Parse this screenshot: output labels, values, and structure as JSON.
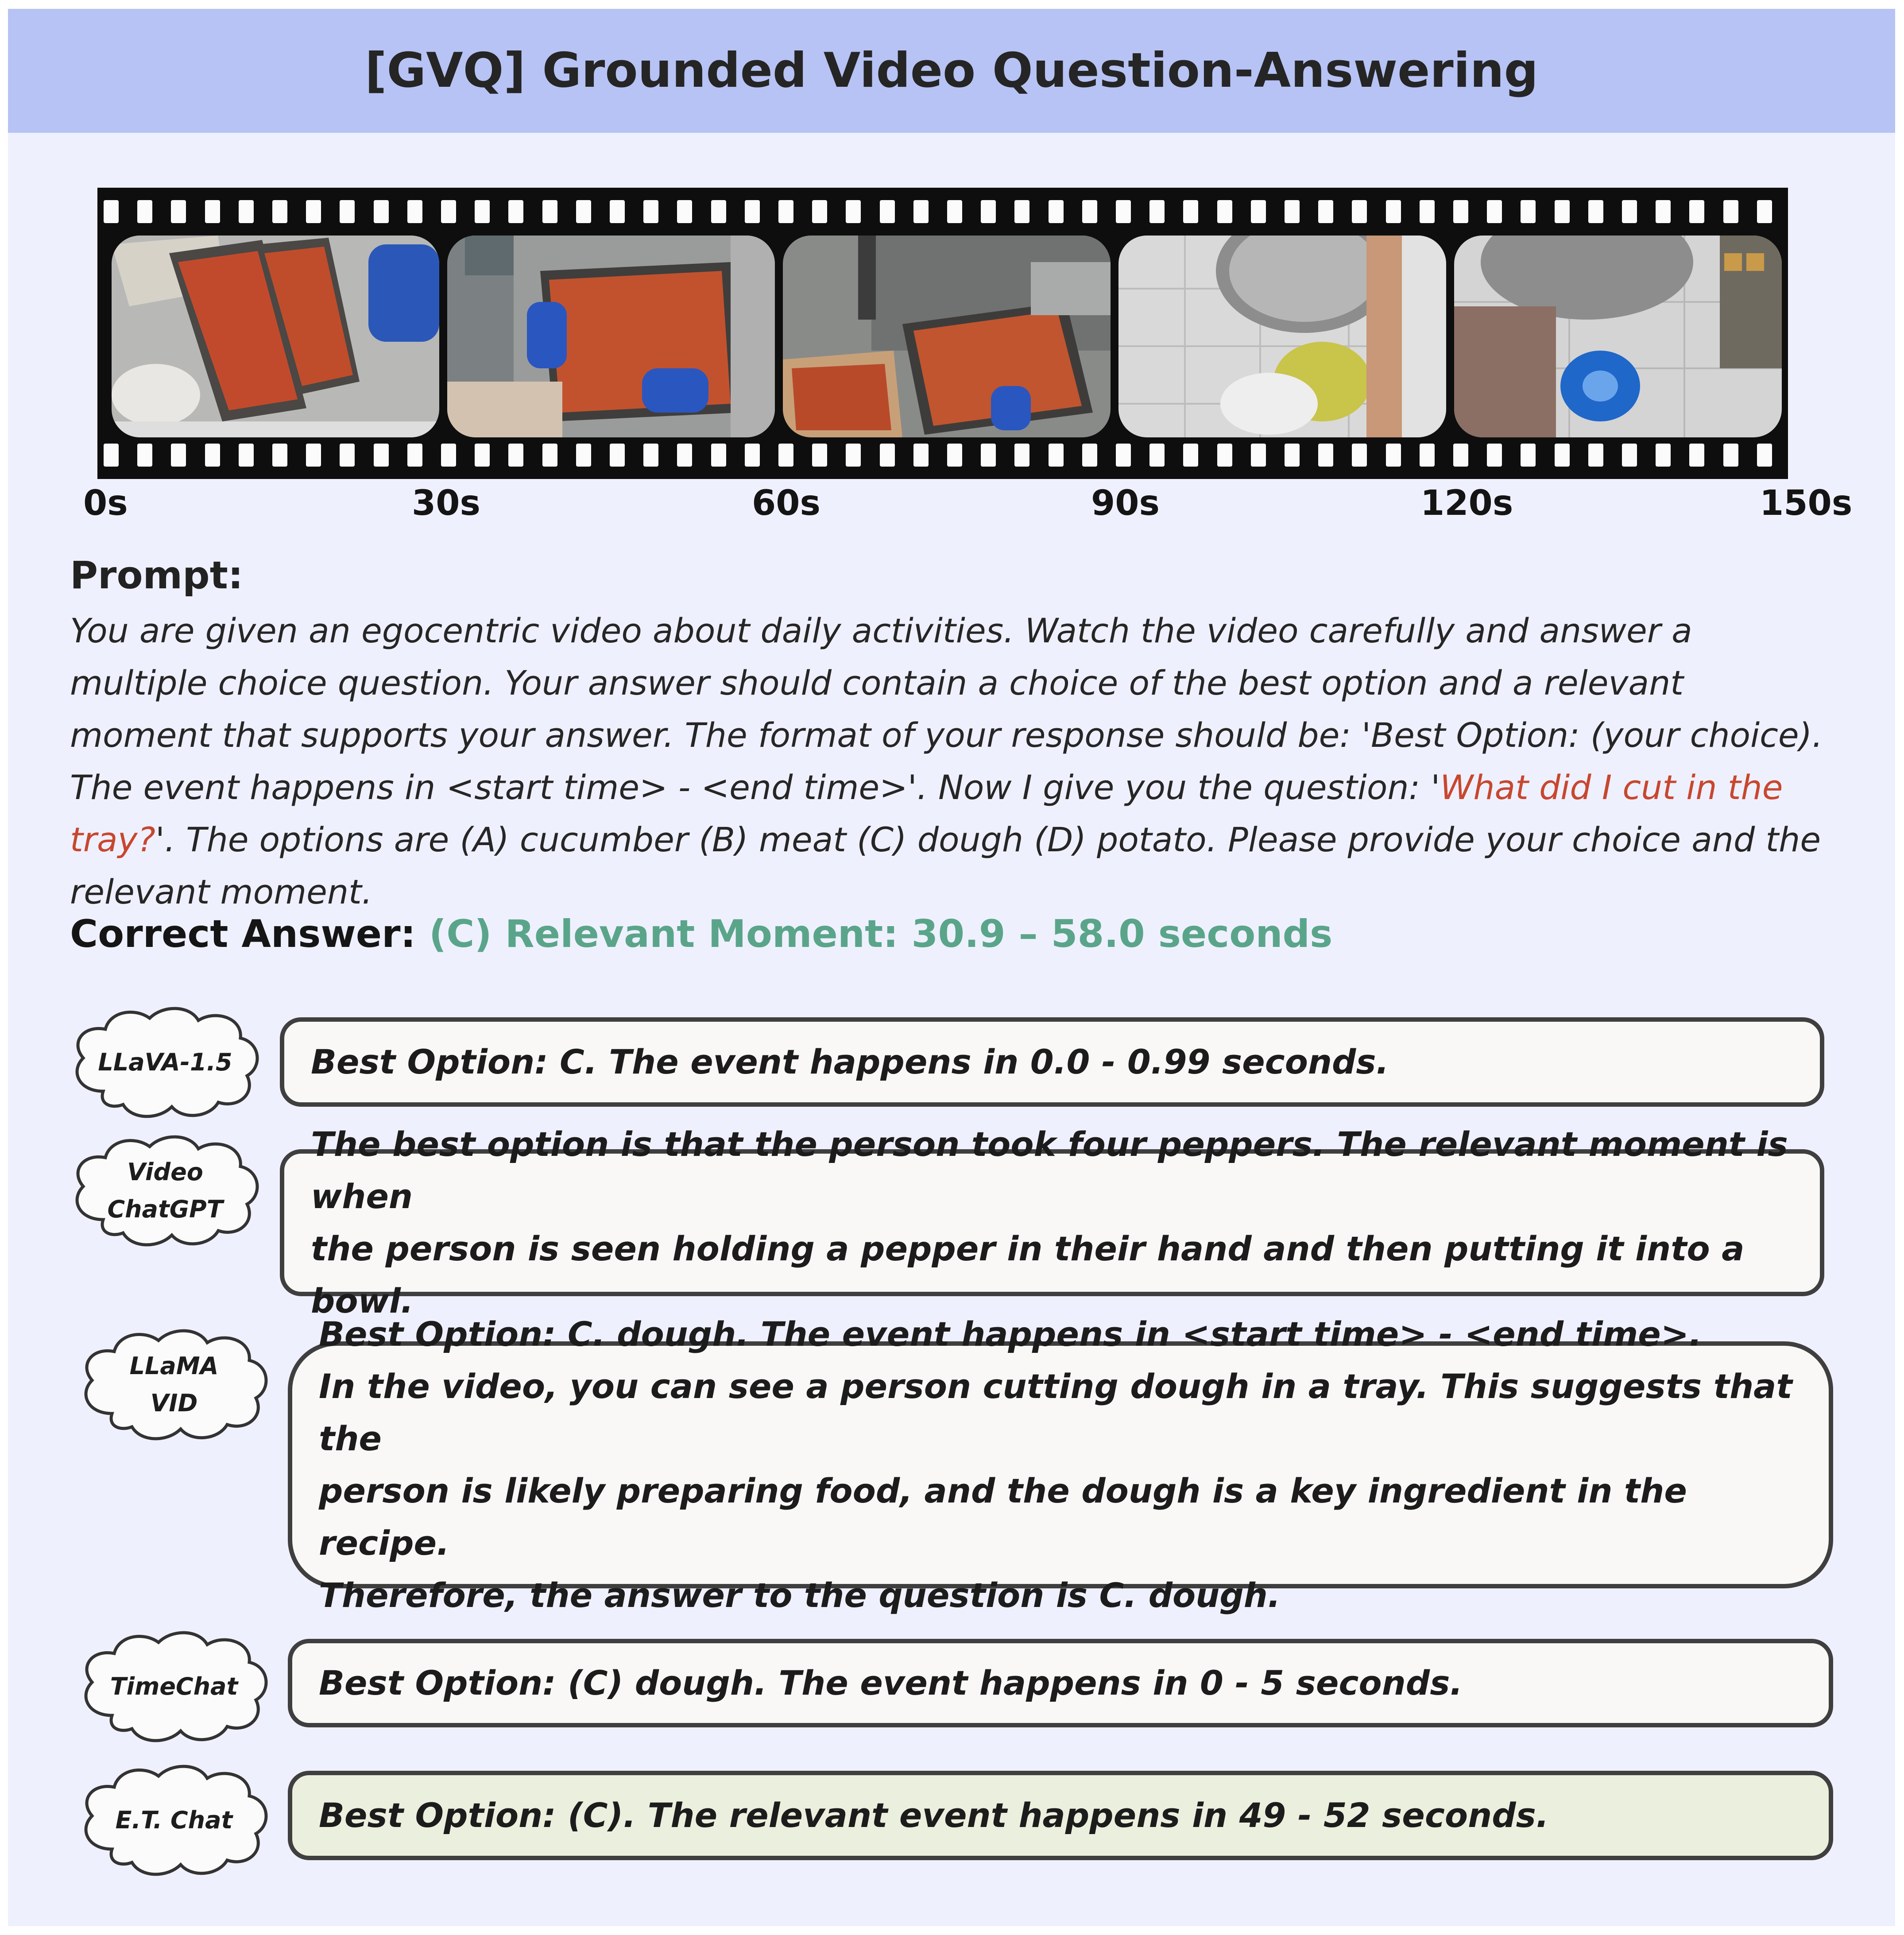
{
  "header": {
    "title": "[GVQ] Grounded Video Question-Answering"
  },
  "filmstrip": {
    "time_labels": [
      "0s",
      "30s",
      "60s",
      "90s",
      "120s",
      "150s"
    ]
  },
  "prompt": {
    "title": "Prompt:",
    "text_before": "You are given an egocentric video about daily activities. Watch the video carefully and answer a multiple choice question. Your answer should contain a choice of the best option and a relevant moment that supports your answer. The format of your response should be: 'Best Option: (your choice). The event happens in <start time> - <end time>'. Now I give you the question: '",
    "question": "What did I cut in the tray?",
    "text_after": "'. The options are (A) cucumber (B) meat (C) dough (D) potato. Please provide your choice and the relevant moment."
  },
  "answer": {
    "label": "Correct Answer:",
    "value": "(C) Relevant Moment: 30.9 – 58.0 seconds"
  },
  "models": [
    {
      "name": "LLaVA-1.5",
      "response": "Best Option: C. The event happens in 0.0 - 0.99 seconds."
    },
    {
      "name": "Video\nChatGPT",
      "response": "The best option is that the person took four peppers. The relevant moment is when\nthe person is seen holding a pepper in their hand and then putting it into a bowl."
    },
    {
      "name": "LLaMA\nVID",
      "response": "Best Option: C. dough. The event happens in <start time> - <end time>.\nIn the video, you can see a person cutting dough in a tray. This suggests that the\nperson is likely preparing food, and the dough is a key ingredient in the recipe.\nTherefore, the answer to the question is C. dough."
    },
    {
      "name": "TimeChat",
      "response": "Best Option: (C) dough. The event happens in 0 - 5 seconds."
    },
    {
      "name": "E.T. Chat",
      "response": "Best Option: (C). The relevant event happens in 49 - 52 seconds."
    }
  ],
  "colors": {
    "header_bg": "#b7c3f4",
    "page_bg": "#eff0fd",
    "question_red": "#c7472e",
    "answer_green": "#5aa58a",
    "highlight_box": "#ebefdd"
  }
}
